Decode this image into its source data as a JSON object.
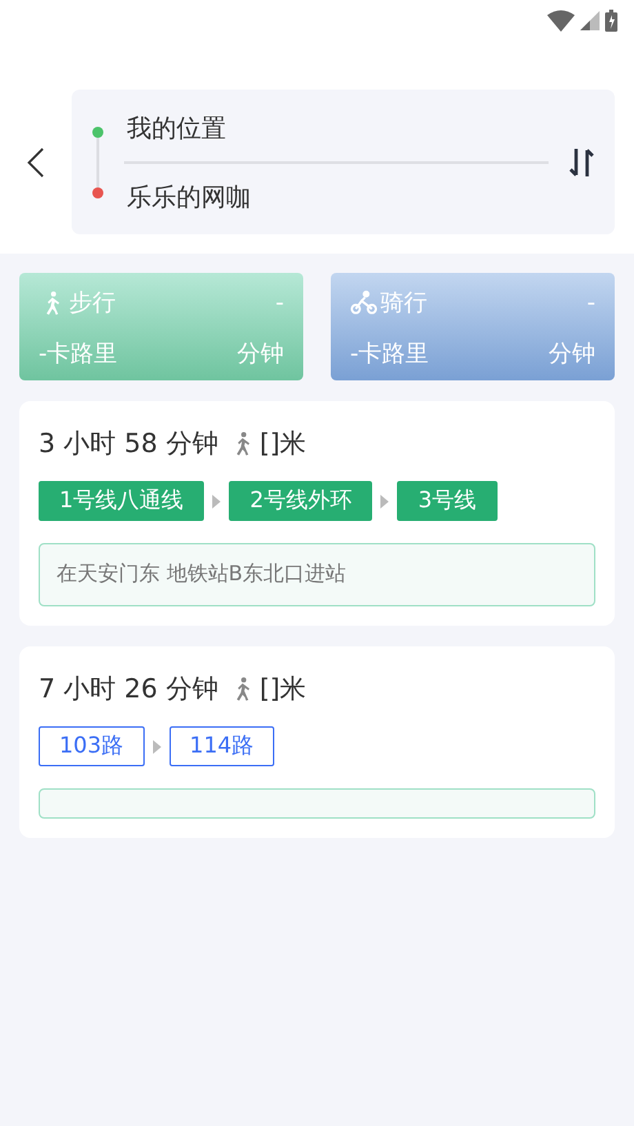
{
  "search": {
    "origin": "我的位置",
    "destination": "乐乐的网咖"
  },
  "modes": [
    {
      "kind": "walk",
      "label": "步行",
      "time": "-",
      "calories": "-卡路里",
      "unit": "分钟"
    },
    {
      "kind": "bike",
      "label": "骑行",
      "time": "-",
      "calories": "-卡路里",
      "unit": "分钟"
    }
  ],
  "routes": [
    {
      "duration": "3 小时 58 分钟",
      "walk": "[]米",
      "lines": [
        {
          "kind": "subway",
          "name": "1号线八通线"
        },
        {
          "kind": "subway",
          "name": "2号线外环"
        },
        {
          "kind": "subway",
          "name": "3号线"
        }
      ],
      "entrance": "在天安门东 地铁站B东北口进站"
    },
    {
      "duration": "7 小时 26 分钟",
      "walk": "[]米",
      "lines": [
        {
          "kind": "bus",
          "name": "103路"
        },
        {
          "kind": "bus",
          "name": "114路"
        }
      ]
    }
  ]
}
